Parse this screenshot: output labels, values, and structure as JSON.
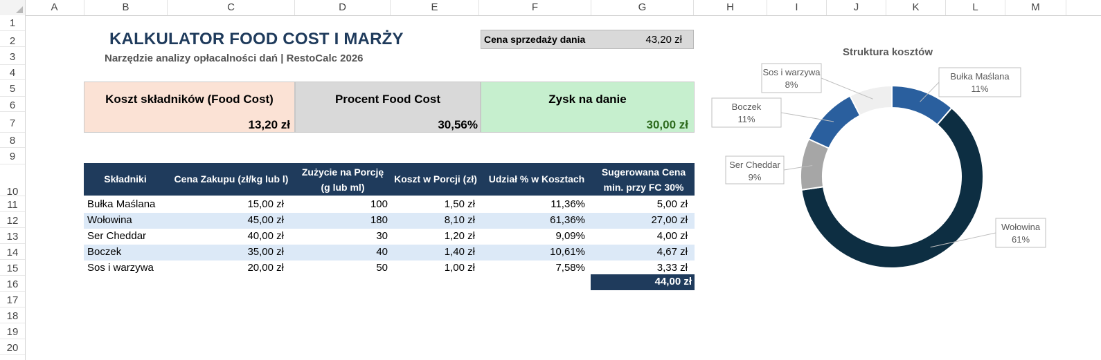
{
  "columns": [
    "A",
    "B",
    "C",
    "D",
    "E",
    "F",
    "G",
    "H",
    "I",
    "J",
    "K",
    "L",
    "M"
  ],
  "rows": [
    "1",
    "2",
    "3",
    "4",
    "5",
    "6",
    "7",
    "8",
    "9",
    "10",
    "11",
    "12",
    "13",
    "14",
    "15",
    "16",
    "17",
    "18",
    "19",
    "20"
  ],
  "title": "KALKULATOR FOOD COST I MARŻY",
  "subtitle": "Narzędzie analizy opłacalności dań | RestoCalc 2026",
  "price": {
    "label": "Cena sprzedaży dania",
    "value": "43,20 zł"
  },
  "kpis": {
    "food_cost": {
      "label": "Koszt składników (Food Cost)",
      "value": "13,20 zł"
    },
    "percent": {
      "label": "Procent Food Cost",
      "value": "30,56%"
    },
    "profit": {
      "label": "Zysk na danie",
      "value": "30,00 zł"
    }
  },
  "table": {
    "headers": {
      "ingredient": "Składniki",
      "price": "Cena Zakupu (zł/kg lub l)",
      "usage_1": "Zużycie na Porcję",
      "usage_2": "(g lub ml)",
      "cost": "Koszt w Porcji (zł)",
      "share": "Udział % w Kosztach",
      "suggested_1": "Sugerowana Cena",
      "suggested_2": "min. przy FC 30%"
    },
    "rows": [
      {
        "name": "Bułka Maślana",
        "price": "15,00 zł",
        "usage": "100",
        "cost": "1,50 zł",
        "share": "11,36%",
        "suggested": "5,00 zł"
      },
      {
        "name": "Wołowina",
        "price": "45,00 zł",
        "usage": "180",
        "cost": "8,10 zł",
        "share": "61,36%",
        "suggested": "27,00 zł"
      },
      {
        "name": "Ser Cheddar",
        "price": "40,00 zł",
        "usage": "30",
        "cost": "1,20 zł",
        "share": "9,09%",
        "suggested": "4,00 zł"
      },
      {
        "name": "Boczek",
        "price": "35,00 zł",
        "usage": "40",
        "cost": "1,40 zł",
        "share": "10,61%",
        "suggested": "4,67 zł"
      },
      {
        "name": "Sos i warzywa",
        "price": "20,00 zł",
        "usage": "50",
        "cost": "1,00 zł",
        "share": "7,58%",
        "suggested": "3,33 zł"
      }
    ],
    "total": "44,00 zł"
  },
  "chart_data": {
    "type": "pie",
    "title": "Struktura kosztów",
    "categories": [
      "Bułka Maślana",
      "Wołowina",
      "Ser Cheddar",
      "Boczek",
      "Sos i warzywa"
    ],
    "values": [
      11.36,
      61.36,
      9.09,
      10.61,
      7.58
    ],
    "data_labels": [
      "11%",
      "61%",
      "9%",
      "11%",
      "8%"
    ],
    "colors": [
      "#2a5f9e",
      "#0d2e42",
      "#a6a6a6",
      "#2a5f9e",
      "#efefef"
    ]
  }
}
